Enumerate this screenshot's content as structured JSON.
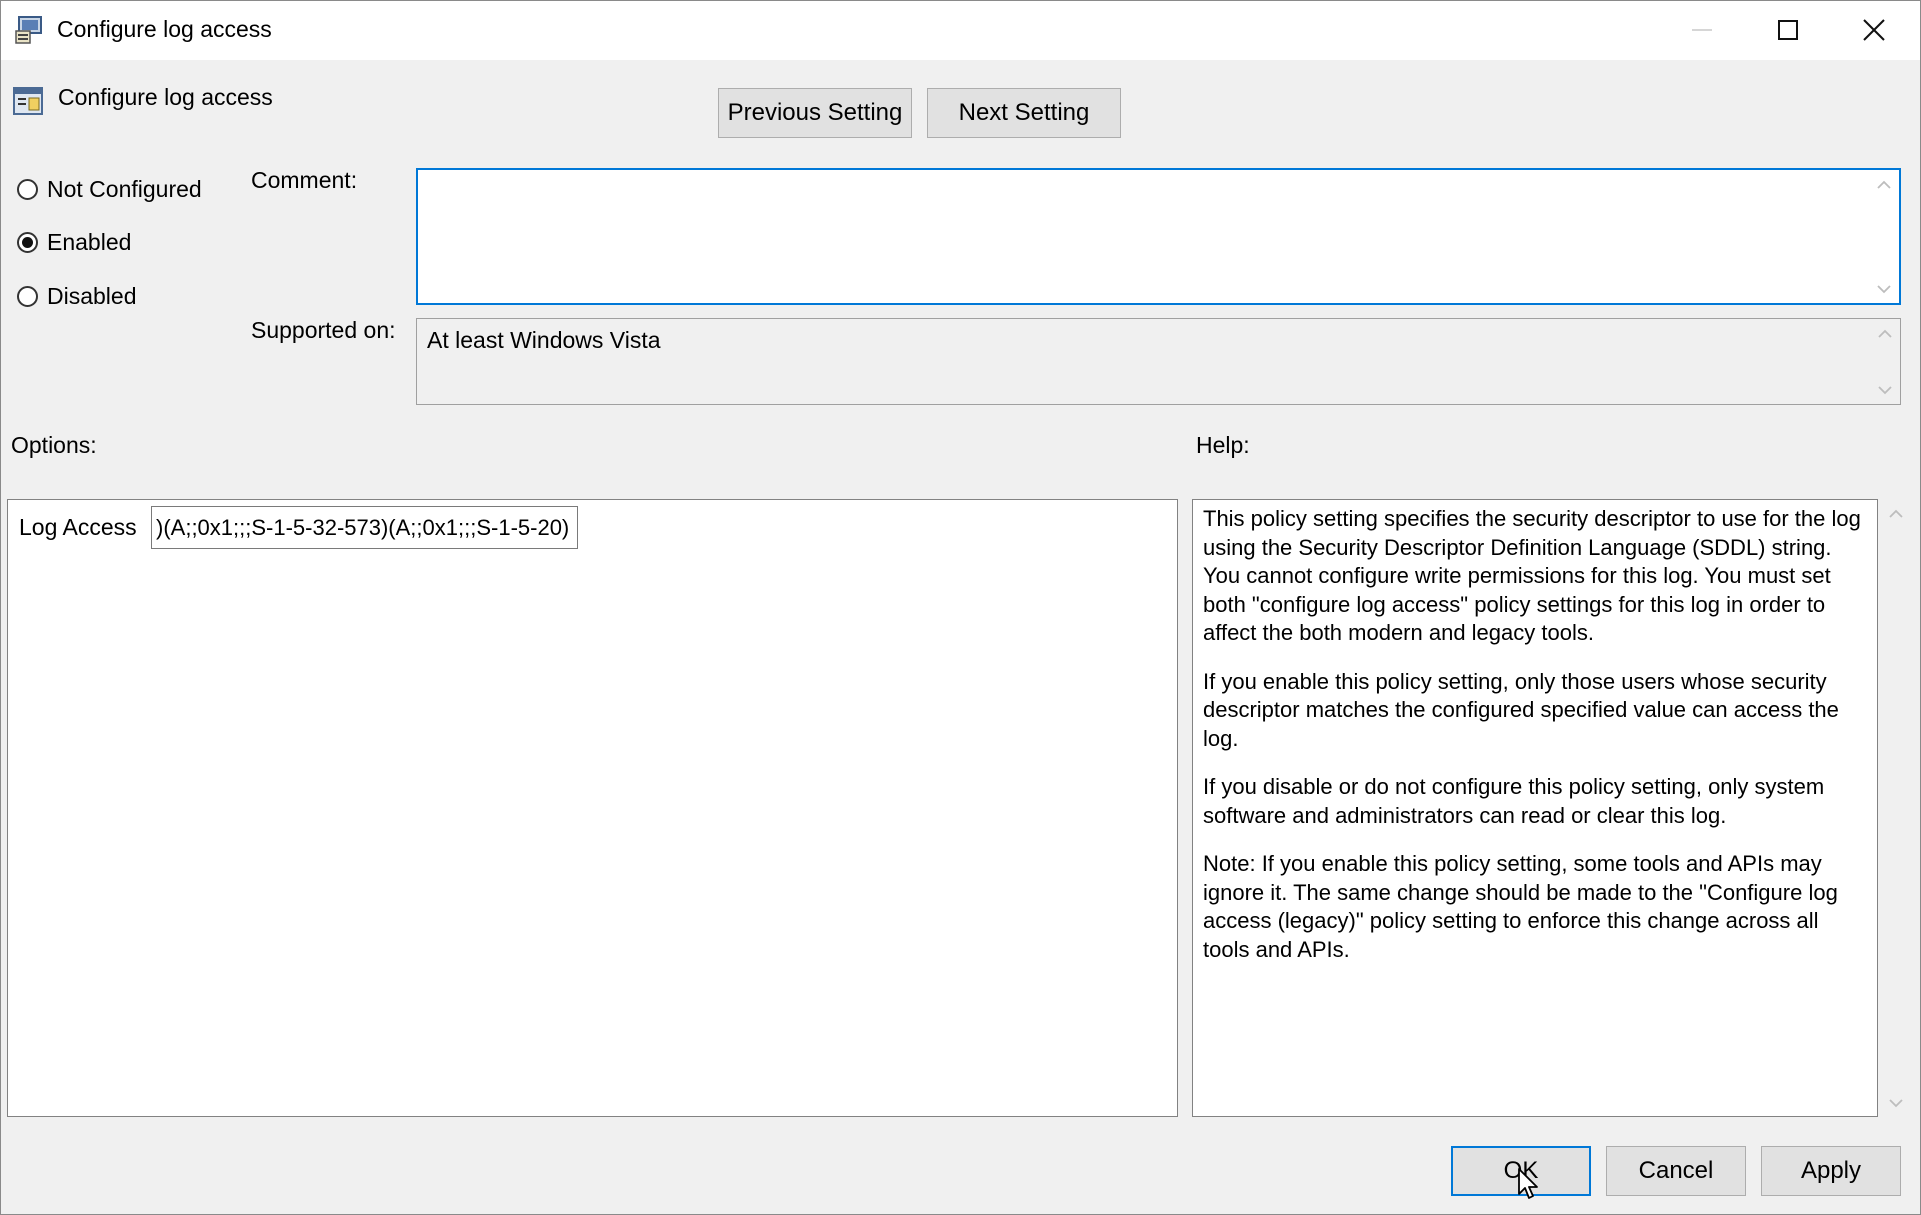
{
  "window": {
    "title": "Configure log access",
    "minimize_icon": "minimize-icon",
    "maximize_icon": "maximize-icon",
    "close_icon": "close-icon"
  },
  "header": {
    "setting_name": "Configure log access",
    "prev_button": "Previous Setting",
    "next_button": "Next Setting"
  },
  "state": {
    "options": [
      {
        "label": "Not Configured",
        "checked": false
      },
      {
        "label": "Enabled",
        "checked": true
      },
      {
        "label": "Disabled",
        "checked": false
      }
    ]
  },
  "comment": {
    "label": "Comment:",
    "value": ""
  },
  "supported": {
    "label": "Supported on:",
    "value": "At least Windows Vista"
  },
  "options_panel": {
    "heading": "Options:",
    "log_access_label": "Log Access",
    "log_access_value": ")(A;;0x1;;;S-1-5-32-573)(A;;0x1;;;S-1-5-20)"
  },
  "help_panel": {
    "heading": "Help:",
    "paragraphs": [
      "This policy setting specifies the security descriptor to use for the log using the Security Descriptor Definition Language (SDDL) string. You cannot configure write permissions for this log. You must set both \"configure log access\" policy settings for this log in order to affect the both modern and legacy tools.",
      "If you enable this policy setting, only those users whose security descriptor matches the configured specified value can access the log.",
      "If you disable or do not configure this policy setting, only system software and administrators can read or clear this log.",
      "Note: If you enable this policy setting, some tools and APIs may ignore it. The same change should be made to the \"Configure log access (legacy)\" policy setting to enforce this change across all tools and APIs."
    ]
  },
  "footer": {
    "ok": "OK",
    "cancel": "Cancel",
    "apply": "Apply"
  },
  "colors": {
    "accent": "#0078d7",
    "button_face": "#e1e1e1",
    "dialog_bg": "#f0f0f0"
  }
}
